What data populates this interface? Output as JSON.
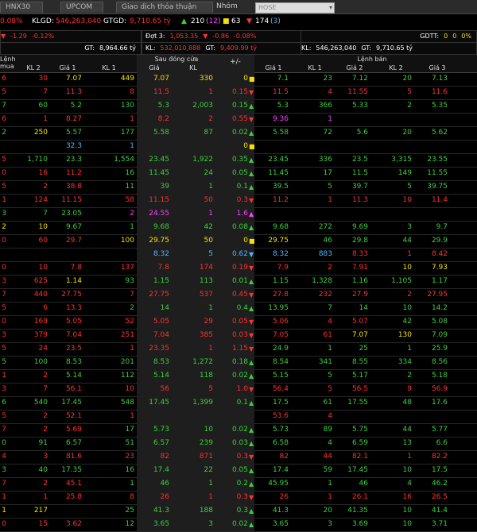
{
  "tabs": {
    "hnx30": "HNX30",
    "upcom": "UPCOM",
    "gdtt": "Giao dịch thỏa thuận",
    "nhom": "Nhóm",
    "exchange": "HOSE"
  },
  "summary": {
    "pct": "0.08%",
    "klgd_label": "KLGD:",
    "klgd": "546,263,040",
    "gtgd_label": "GTGD:",
    "gtgd": "9,710.65 tỷ",
    "up": "210",
    "up_ceiling": "12",
    "flat": "63",
    "down": "174",
    "down_floor": "3"
  },
  "index_boxes": [
    {
      "change": "-1.29",
      "pct": "-0.12%",
      "gt_label": "GT:",
      "gt": "8,964.66 tỷ"
    },
    {
      "session": "Đợt 3:",
      "value": "1,053.35",
      "change": "-0.86",
      "pct": "-0.08%",
      "kl_label": "KL:",
      "kl": "532,010,888",
      "gt_label": "GT:",
      "gt": "9,409.99 tỷ"
    },
    {
      "gdtt_label": "GDTT:",
      "gdtt1": "0",
      "gdtt2": "0",
      "gdtt3": "0%",
      "kl_label": "KL:",
      "kl": "546,263,040",
      "gt_label": "GT:",
      "gt": "9,710.65 tỷ"
    }
  ],
  "header": {
    "buy": "Lệnh mua",
    "close": "Sau đóng cửa",
    "change": "+/-",
    "sell": "Lệnh bán",
    "kl2": "KL 2",
    "gia1": "Giá 1",
    "kl1": "KL 1",
    "gia": "Giá",
    "kl": "KL",
    "s_gia1": "Giá 1",
    "s_kl1": "KL 1",
    "s_gia2": "Giá 2",
    "s_kl2": "KL 2",
    "s_gia3": "Giá 3"
  },
  "colors": {
    "up": "#3ecf3e",
    "down": "#ff3030",
    "ref": "#f5e000",
    "ceil": "#ff3cff",
    "floor": "#4db8ff"
  },
  "rows": [
    [
      "6",
      "r",
      "30",
      "r",
      "7.07",
      "y",
      "449",
      "y",
      "7.07",
      "y",
      "330",
      "y",
      "0",
      "y",
      "7.1",
      "g",
      "23",
      "g",
      "7.12",
      "g",
      "20",
      "g",
      "7.13",
      "g"
    ],
    [
      "5",
      "r",
      "7",
      "r",
      "11.3",
      "r",
      "8",
      "r",
      "11.5",
      "r",
      "1",
      "r",
      "0.15",
      "r",
      "11.5",
      "r",
      "4",
      "r",
      "11.55",
      "r",
      "5",
      "r",
      "11.6",
      "r"
    ],
    [
      "7",
      "g",
      "60",
      "g",
      "5.2",
      "g",
      "130",
      "g",
      "5.3",
      "g",
      "2,003",
      "g",
      "0.15",
      "g",
      "5.3",
      "g",
      "366",
      "g",
      "5.33",
      "g",
      "2",
      "g",
      "5.35",
      "g"
    ],
    [
      "6",
      "r",
      "1",
      "r",
      "8.27",
      "r",
      "1",
      "r",
      "8.2",
      "r",
      "2",
      "r",
      "0.55",
      "r",
      "9.36",
      "m",
      "1",
      "m",
      "",
      "",
      "",
      "",
      "",
      " "
    ],
    [
      "2",
      "g",
      "250",
      "y",
      "5.57",
      "g",
      "177",
      "g",
      "5.58",
      "g",
      "87",
      "g",
      "0.02",
      "g",
      "5.58",
      "g",
      "72",
      "g",
      "5.6",
      "g",
      "20",
      "g",
      "5.62",
      "g"
    ],
    [
      "",
      "",
      "",
      "",
      "32.3",
      "cy",
      "1",
      "cy",
      "",
      "",
      "",
      "",
      "0",
      "y",
      "",
      "",
      "",
      "",
      "",
      "",
      "",
      "",
      "",
      ""
    ],
    [
      "5",
      "r",
      "1,710",
      "g",
      "23.3",
      "g",
      "1,554",
      "g",
      "23.45",
      "g",
      "1,922",
      "g",
      "0.35",
      "g",
      "23.45",
      "g",
      "336",
      "g",
      "23.5",
      "g",
      "3,315",
      "g",
      "23.55",
      "g"
    ],
    [
      "0",
      "r",
      "16",
      "r",
      "11.2",
      "r",
      "16",
      "g",
      "11.45",
      "g",
      "24",
      "g",
      "0.05",
      "g",
      "11.45",
      "g",
      "17",
      "g",
      "11.5",
      "g",
      "149",
      "g",
      "11.55",
      "g"
    ],
    [
      "5",
      "r",
      "2",
      "r",
      "38.8",
      "r",
      "11",
      "g",
      "39",
      "g",
      "1",
      "g",
      "0.1",
      "g",
      "39.5",
      "g",
      "5",
      "g",
      "39.7",
      "g",
      "5",
      "g",
      "39.75",
      "g"
    ],
    [
      "1",
      "r",
      "124",
      "r",
      "11.15",
      "r",
      "58",
      "r",
      "11.15",
      "r",
      "50",
      "r",
      "0.3",
      "r",
      "11.2",
      "r",
      "1",
      "r",
      "11.3",
      "r",
      "10",
      "r",
      "11.4",
      "r"
    ],
    [
      "3",
      "g",
      "7",
      "g",
      "23.05",
      "g",
      "2",
      "m",
      "24.55",
      "m",
      "1",
      "m",
      "1.6",
      "m",
      "",
      "",
      "",
      "",
      "",
      "",
      "",
      "",
      "",
      ""
    ],
    [
      "2",
      "y",
      "10",
      "y",
      "9.67",
      "g",
      "1",
      "g",
      "9.68",
      "g",
      "42",
      "g",
      "0.08",
      "g",
      "9.68",
      "g",
      "272",
      "g",
      "9.69",
      "g",
      "3",
      "g",
      "9.7",
      "g"
    ],
    [
      "0",
      "r",
      "60",
      "r",
      "29.7",
      "r",
      "100",
      "y",
      "29.75",
      "y",
      "50",
      "y",
      "0",
      "y",
      "29.75",
      "y",
      "46",
      "g",
      "29.8",
      "g",
      "44",
      "g",
      "29.9",
      "g"
    ],
    [
      "",
      "",
      "",
      "",
      "",
      "",
      "",
      "",
      "8.32",
      "cy",
      "5",
      "cy",
      "0.62",
      "cy",
      "8.32",
      "cy",
      "883",
      "cy",
      "8.33",
      "r",
      "1",
      "r",
      "8.42",
      "r"
    ],
    [
      "0",
      "r",
      "10",
      "r",
      "7.8",
      "r",
      "137",
      "r",
      "7.8",
      "r",
      "174",
      "r",
      "0.19",
      "r",
      "7.9",
      "r",
      "2",
      "r",
      "7.91",
      "r",
      "10",
      "y",
      "7.93",
      "y"
    ],
    [
      "3",
      "r",
      "625",
      "r",
      "1.14",
      "y",
      "93",
      "g",
      "1.15",
      "g",
      "113",
      "g",
      "0.01",
      "g",
      "1.15",
      "g",
      "1,328",
      "g",
      "1.16",
      "g",
      "1,105",
      "g",
      "1.17",
      "g"
    ],
    [
      "7",
      "r",
      "440",
      "r",
      "27.75",
      "r",
      "7",
      "r",
      "27.75",
      "r",
      "537",
      "r",
      "0.45",
      "r",
      "27.8",
      "r",
      "232",
      "r",
      "27.9",
      "r",
      "2",
      "r",
      "27.95",
      "r"
    ],
    [
      "5",
      "r",
      "6",
      "r",
      "13.3",
      "r",
      "2",
      "g",
      "14",
      "g",
      "1",
      "g",
      "0.4",
      "g",
      "13.95",
      "g",
      "7",
      "g",
      "14",
      "g",
      "10",
      "g",
      "14.2",
      "g"
    ],
    [
      "0",
      "r",
      "169",
      "r",
      "5.05",
      "r",
      "52",
      "r",
      "5.05",
      "r",
      "29",
      "r",
      "0.05",
      "r",
      "5.06",
      "r",
      "4",
      "r",
      "5.07",
      "r",
      "42",
      "g",
      "5.08",
      "g"
    ],
    [
      "3",
      "r",
      "379",
      "r",
      "7.04",
      "r",
      "251",
      "r",
      "7.04",
      "r",
      "385",
      "r",
      "0.03",
      "r",
      "7.05",
      "r",
      "61",
      "r",
      "7.07",
      "y",
      "130",
      "y",
      "7.09",
      "g"
    ],
    [
      "5",
      "r",
      "24",
      "r",
      "23.5",
      "r",
      "1",
      "r",
      "23.35",
      "r",
      "1",
      "r",
      "1.15",
      "r",
      "24.9",
      "g",
      "1",
      "g",
      "25",
      "g",
      "1",
      "g",
      "25.9",
      "g"
    ],
    [
      "5",
      "g",
      "100",
      "g",
      "8.53",
      "g",
      "201",
      "g",
      "8.53",
      "g",
      "1,272",
      "g",
      "0.18",
      "g",
      "8.54",
      "g",
      "341",
      "g",
      "8.55",
      "g",
      "334",
      "g",
      "8.56",
      "g"
    ],
    [
      "1",
      "r",
      "2",
      "r",
      "5.14",
      "g",
      "112",
      "g",
      "5.14",
      "g",
      "118",
      "g",
      "0.02",
      "g",
      "5.15",
      "g",
      "5",
      "g",
      "5.17",
      "g",
      "2",
      "g",
      "5.18",
      "g"
    ],
    [
      "3",
      "r",
      "7",
      "r",
      "56.1",
      "r",
      "10",
      "r",
      "56",
      "r",
      "5",
      "r",
      "1.0",
      "r",
      "56.4",
      "r",
      "5",
      "r",
      "56.5",
      "r",
      "9",
      "r",
      "56.9",
      "r"
    ],
    [
      "6",
      "g",
      "540",
      "g",
      "17.45",
      "g",
      "548",
      "g",
      "17.45",
      "g",
      "1,399",
      "g",
      "0.1",
      "g",
      "17.5",
      "g",
      "61",
      "g",
      "17.55",
      "g",
      "48",
      "g",
      "17.6",
      "g"
    ],
    [
      "5",
      "r",
      "2",
      "r",
      "52.1",
      "r",
      "1",
      "r",
      "",
      "",
      "",
      "",
      "",
      "",
      "53.6",
      "r",
      "4",
      "r",
      "",
      "",
      "",
      "",
      "",
      ""
    ],
    [
      "7",
      "r",
      "2",
      "r",
      "5.69",
      "r",
      "17",
      "g",
      "5.73",
      "g",
      "10",
      "g",
      "0.02",
      "g",
      "5.73",
      "g",
      "89",
      "g",
      "5.75",
      "g",
      "44",
      "g",
      "5.77",
      "g"
    ],
    [
      "0",
      "g",
      "91",
      "g",
      "6.57",
      "g",
      "51",
      "g",
      "6.57",
      "g",
      "239",
      "g",
      "0.03",
      "g",
      "6.58",
      "g",
      "4",
      "g",
      "6.59",
      "g",
      "13",
      "g",
      "6.6",
      "g"
    ],
    [
      "4",
      "r",
      "3",
      "r",
      "81.6",
      "r",
      "23",
      "r",
      "82",
      "r",
      "871",
      "r",
      "0.3",
      "r",
      "82",
      "r",
      "44",
      "r",
      "82.1",
      "r",
      "1",
      "r",
      "82.2",
      "r"
    ],
    [
      "3",
      "g",
      "40",
      "g",
      "17.35",
      "g",
      "16",
      "g",
      "17.4",
      "g",
      "22",
      "g",
      "0.05",
      "g",
      "17.4",
      "g",
      "59",
      "g",
      "17.45",
      "g",
      "10",
      "g",
      "17.5",
      "g"
    ],
    [
      "7",
      "r",
      "2",
      "r",
      "45.1",
      "r",
      "1",
      "g",
      "46",
      "g",
      "1",
      "g",
      "0.2",
      "g",
      "45.95",
      "g",
      "1",
      "g",
      "46",
      "g",
      "4",
      "g",
      "46.2",
      "g"
    ],
    [
      "1",
      "r",
      "1",
      "r",
      "25.8",
      "r",
      "8",
      "r",
      "26",
      "r",
      "1",
      "r",
      "0.3",
      "r",
      "26",
      "r",
      "1",
      "r",
      "26.1",
      "r",
      "16",
      "r",
      "26.5",
      "r"
    ],
    [
      "1",
      "y",
      "217",
      "y",
      "",
      "",
      "25",
      "g",
      "41.3",
      "g",
      "188",
      "g",
      "0.3",
      "g",
      "41.3",
      "g",
      "20",
      "g",
      "41.35",
      "g",
      "10",
      "g",
      "41.4",
      "g"
    ],
    [
      "0",
      "r",
      "15",
      "r",
      "3.62",
      "r",
      "12",
      "g",
      "3.65",
      "g",
      "3",
      "g",
      "0.02",
      "g",
      "3.65",
      "g",
      "3",
      "g",
      "3.69",
      "g",
      "10",
      "g",
      "3.71",
      "g"
    ]
  ]
}
